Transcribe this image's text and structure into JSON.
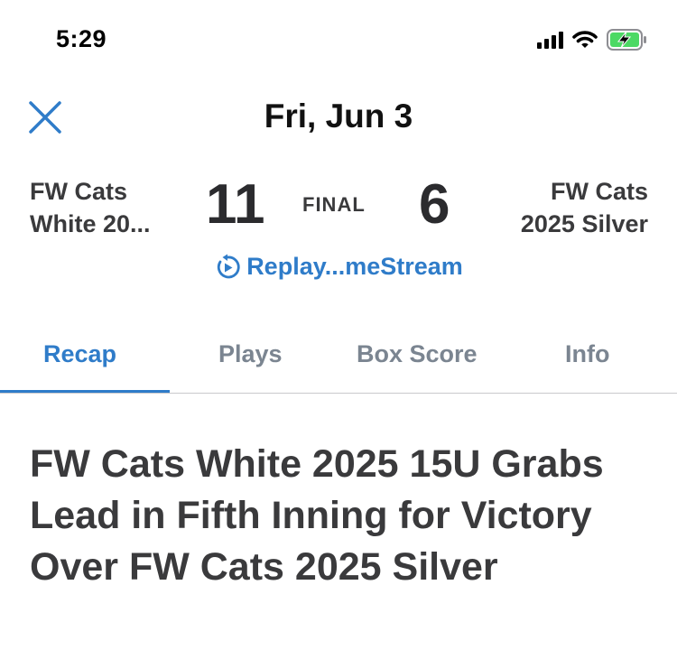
{
  "status_bar": {
    "time": "5:29",
    "icons": [
      "cellular-signal-icon",
      "wifi-icon",
      "battery-charging-icon"
    ]
  },
  "header": {
    "close_icon": "close-icon",
    "title": "Fri, Jun 3"
  },
  "game": {
    "home_team_line1": "FW Cats",
    "home_team_line2": "White 20...",
    "home_score": "11",
    "status": "FINAL",
    "away_score": "6",
    "away_team_line1": "FW Cats",
    "away_team_line2": "2025 Silver",
    "replay_label": "Replay...meStream",
    "replay_icon": "replay-icon"
  },
  "tabs": [
    {
      "label": "Recap",
      "active": true
    },
    {
      "label": "Plays",
      "active": false
    },
    {
      "label": "Box Score",
      "active": false
    },
    {
      "label": "Info",
      "active": false
    }
  ],
  "recap": {
    "headline": "FW Cats White 2025 15U Grabs Lead in Fifth Inning for Victory Over FW Cats 2025 Silver"
  },
  "colors": {
    "accent": "#2f7cc9",
    "inactive_tab": "#7b8591",
    "text_dark": "#3a3a3c",
    "battery_green": "#4cd964"
  }
}
